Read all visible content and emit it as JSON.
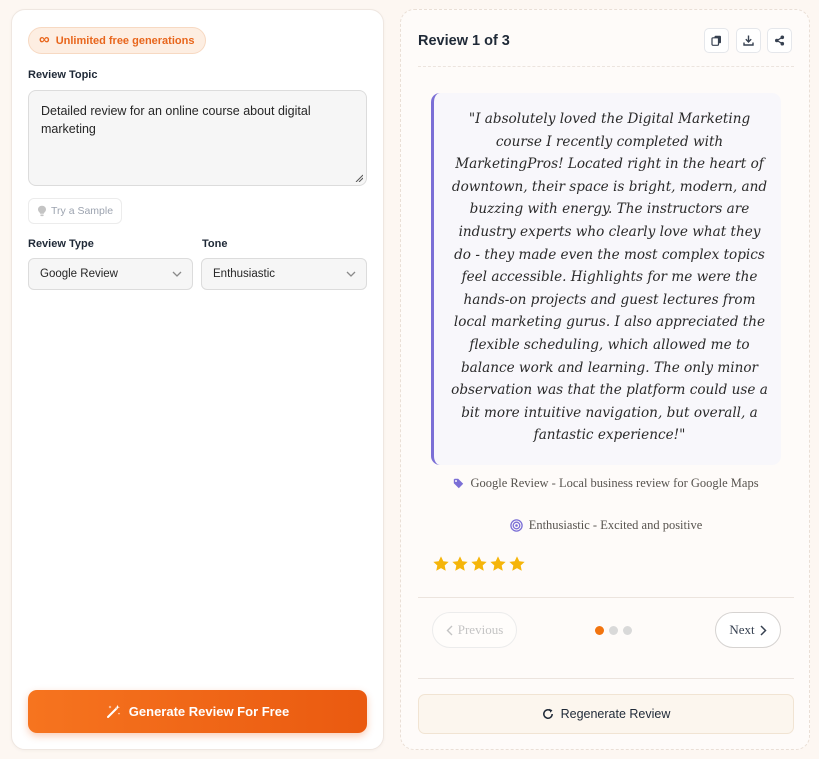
{
  "badge": {
    "icon": "infinity-icon",
    "label": "Unlimited free generations"
  },
  "form": {
    "topic_label": "Review Topic",
    "topic_value": "Detailed review for an online course about digital marketing",
    "sample_label": "Try a Sample",
    "type_label": "Review Type",
    "type_value": "Google Review",
    "tone_label": "Tone",
    "tone_value": "Enthusiastic",
    "generate_label": "Generate Review For Free"
  },
  "review": {
    "title": "Review 1 of 3",
    "text": "\"I absolutely loved the Digital Marketing course I recently completed with MarketingPros! Located right in the heart of downtown, their space is bright, modern, and buzzing with energy. The instructors are industry experts who clearly love what they do - they made even the most complex topics feel accessible. Highlights for me were the hands-on projects and guest lectures from local marketing gurus. I also appreciated the flexible scheduling, which allowed me to balance work and learning. The only minor observation was that the platform could use a bit more intuitive navigation, but overall, a fantastic experience!\"",
    "type_meta": "Google Review - Local business review for Google Maps",
    "tone_meta": "Enthusiastic - Excited and positive",
    "rating": 5,
    "rating_max": 5,
    "current_page": 1,
    "total_pages": 3,
    "prev_label": "Previous",
    "next_label": "Next",
    "regenerate_label": "Regenerate Review"
  },
  "colors": {
    "accent": "#f2740f",
    "quote_border": "#7b6fd6",
    "star": "#f5b50a"
  }
}
